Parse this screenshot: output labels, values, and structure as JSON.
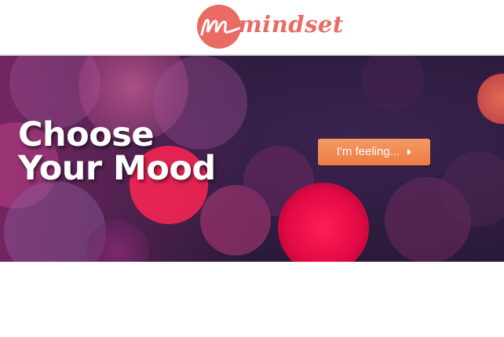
{
  "brand": {
    "name": "mindset",
    "logo_letter": "m",
    "color": "#ea6b63"
  },
  "hero": {
    "title_line_1": "Choose",
    "title_line_2": "Your Mood",
    "cta_label": "I'm feeling...",
    "cta_icon": "caret-right-icon",
    "cta_color": "#ef8550"
  }
}
